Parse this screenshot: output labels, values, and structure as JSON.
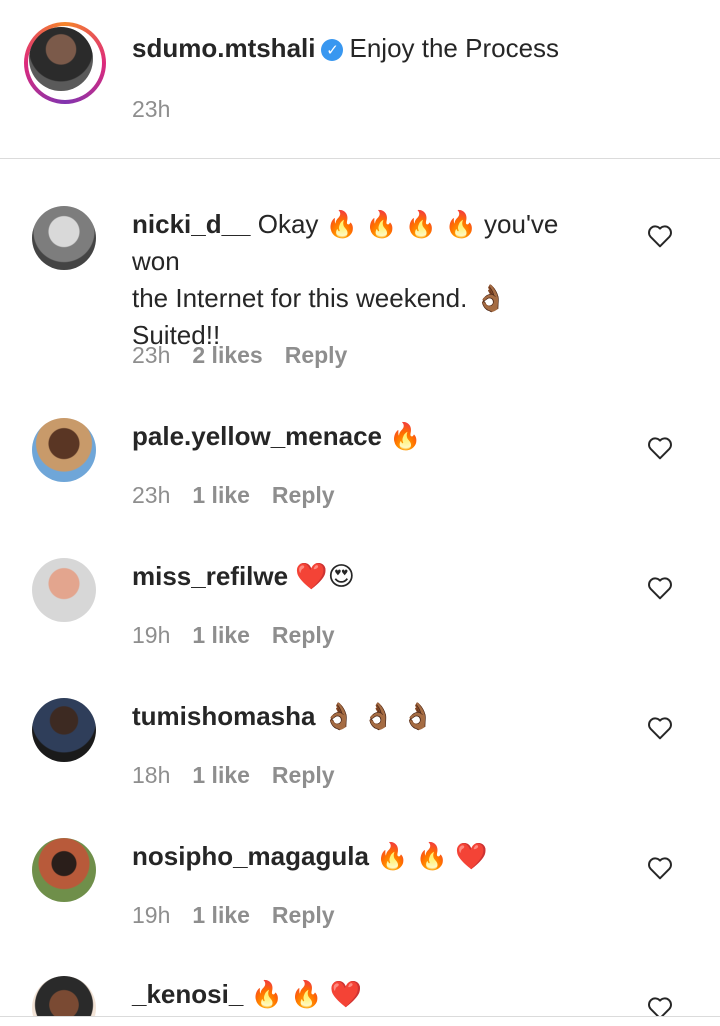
{
  "caption": {
    "username": "sdumo.mtshali",
    "verified_icon": "verified-badge-icon",
    "text": "Enjoy the Process",
    "time": "23h"
  },
  "comments": [
    {
      "username": "nicki_d__",
      "text_line1": "Okay 🔥 🔥 🔥 🔥 you've won",
      "text_line2": "the Internet for this weekend. 👌🏾",
      "text_line3": "Suited!!",
      "time": "23h",
      "likes": "2 likes",
      "reply": "Reply"
    },
    {
      "username": "pale.yellow_menace",
      "text_line1": "🔥",
      "time": "23h",
      "likes": "1 like",
      "reply": "Reply"
    },
    {
      "username": "miss_refilwe",
      "text_line1": "❤️😍",
      "time": "19h",
      "likes": "1 like",
      "reply": "Reply"
    },
    {
      "username": "tumishomasha",
      "text_line1": "👌🏾 👌🏾 👌🏾",
      "time": "18h",
      "likes": "1 like",
      "reply": "Reply"
    },
    {
      "username": "nosipho_magagula",
      "text_line1": "🔥 🔥 ❤️",
      "time": "19h",
      "likes": "1 like",
      "reply": "Reply"
    },
    {
      "username": "_kenosi_",
      "text_line1": "🔥 🔥 ❤️"
    }
  ],
  "icons": {
    "like": "heart-outline-icon",
    "avatar": "profile-avatar"
  }
}
